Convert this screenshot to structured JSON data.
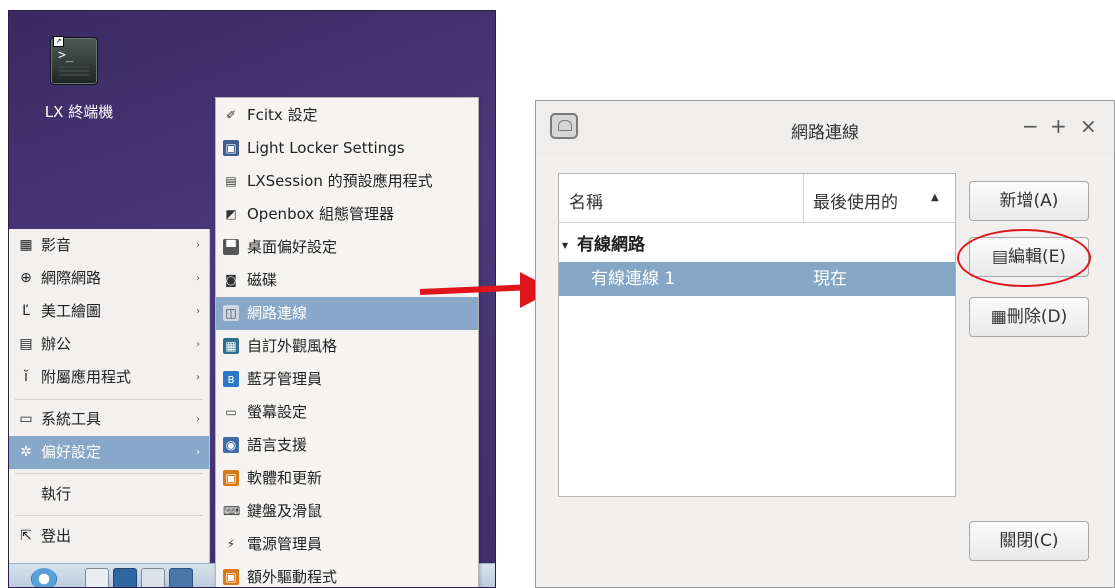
{
  "desktop": {
    "terminal_label": "LX 終端機",
    "main_menu": [
      {
        "icon": "video-icon",
        "glyph": "▦",
        "label": "影音",
        "arrow": "›"
      },
      {
        "icon": "globe-icon",
        "glyph": "⊕",
        "label": "網際網路",
        "arrow": "›"
      },
      {
        "icon": "paint-icon",
        "glyph": "Ľ",
        "label": "美工繪圖",
        "arrow": "›"
      },
      {
        "icon": "office-icon",
        "glyph": "▤",
        "label": "辦公",
        "arrow": "›"
      },
      {
        "icon": "accessories-icon",
        "glyph": "ĭ",
        "label": "附屬應用程式",
        "arrow": "›"
      },
      {
        "icon": "system-tools-icon",
        "glyph": "▭",
        "label": "系統工具",
        "arrow": "›"
      },
      {
        "icon": "preferences-icon",
        "glyph": "✲",
        "label": "偏好設定",
        "arrow": "›"
      },
      {
        "icon": "",
        "glyph": "",
        "label": "執行",
        "arrow": ""
      },
      {
        "icon": "logout-icon",
        "glyph": "⇱",
        "label": "登出",
        "arrow": ""
      }
    ],
    "sub_menu": [
      {
        "icon": "fcitx-icon",
        "glyph": "✐",
        "label": "Fcitx 設定",
        "bg": "#f5f4f2",
        "fg": "#333"
      },
      {
        "icon": "light-locker-icon",
        "glyph": "▣",
        "label": "Light Locker Settings",
        "bg": "#3d5d8a",
        "fg": "#fff"
      },
      {
        "icon": "lxsession-icon",
        "glyph": "▤",
        "label": "LXSession 的預設應用程式",
        "bg": "#f5f4f2",
        "fg": "#333"
      },
      {
        "icon": "openbox-icon",
        "glyph": "◩",
        "label": "Openbox 組態管理器",
        "bg": "#f5f4f2",
        "fg": "#333"
      },
      {
        "icon": "desktop-pref-icon",
        "glyph": "▀",
        "label": "桌面偏好設定",
        "bg": "#555",
        "fg": "#fff"
      },
      {
        "icon": "disk-icon",
        "glyph": "◙",
        "label": "磁碟",
        "bg": "#f5f4f2",
        "fg": "#333"
      },
      {
        "icon": "network-icon",
        "glyph": "◫",
        "label": "網路連線",
        "bg": "#cfd8e2",
        "fg": "#445"
      },
      {
        "icon": "appearance-icon",
        "glyph": "▦",
        "label": "自訂外觀風格",
        "bg": "#2f6d8f",
        "fg": "#fff"
      },
      {
        "icon": "bluetooth-icon",
        "glyph": "ʙ",
        "label": "藍牙管理員",
        "bg": "#2f78c8",
        "fg": "#fff"
      },
      {
        "icon": "monitor-icon",
        "glyph": "▭",
        "label": "螢幕設定",
        "bg": "#f5f4f2",
        "fg": "#333"
      },
      {
        "icon": "language-icon",
        "glyph": "◉",
        "label": "語言支援",
        "bg": "#3f6ca6",
        "fg": "#fff"
      },
      {
        "icon": "software-update-icon",
        "glyph": "▣",
        "label": "軟體和更新",
        "bg": "#d67a1a",
        "fg": "#fff"
      },
      {
        "icon": "keyboard-icon",
        "glyph": "⌨",
        "label": "鍵盤及滑鼠",
        "bg": "#f5f4f2",
        "fg": "#333"
      },
      {
        "icon": "power-icon",
        "glyph": "⚡",
        "label": "電源管理員",
        "bg": "#f5f4f2",
        "fg": "#333"
      },
      {
        "icon": "drivers-icon",
        "glyph": "▣",
        "label": "額外驅動程式",
        "bg": "#d67a1a",
        "fg": "#fff"
      }
    ]
  },
  "dialog": {
    "title": "網路連線",
    "minimize": "−",
    "maximize": "+",
    "close": "×",
    "columns": {
      "name": "名稱",
      "last_used": "最後使用的"
    },
    "sort_indicator": "▲",
    "group": {
      "expander": "▾",
      "label": "有線網路"
    },
    "connection": {
      "name": "有線連線 1",
      "last_used": "現在"
    },
    "buttons": {
      "add": "新增(A)",
      "edit_icon": "▤",
      "edit": "編輯(E)",
      "delete_icon": "▦",
      "delete": "刪除(D)",
      "close": "關閉(C)"
    }
  },
  "colors": {
    "selection": "#87a8c8",
    "annotation": "#e0151c"
  }
}
